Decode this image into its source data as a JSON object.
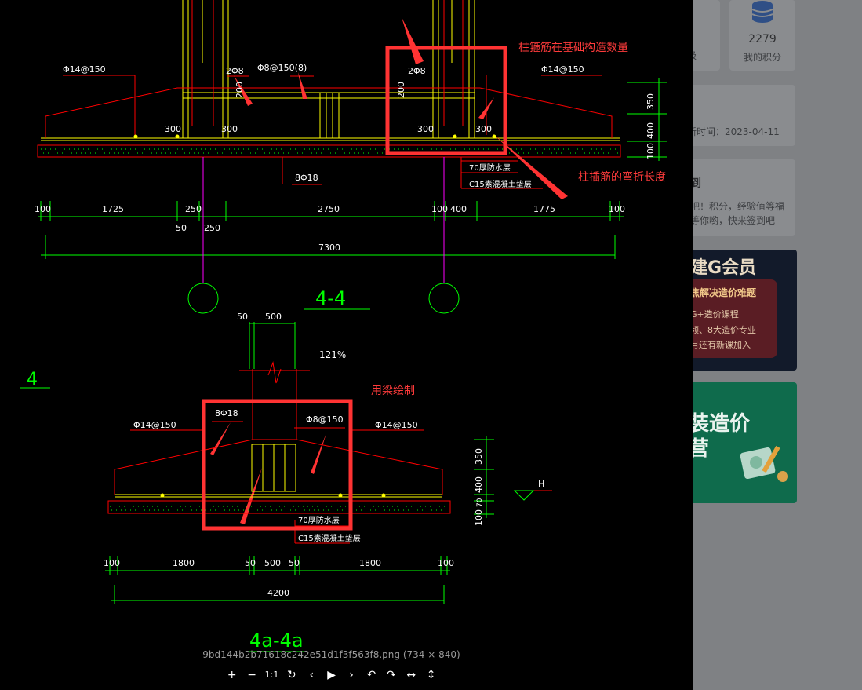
{
  "sidebar": {
    "points_value": "2279",
    "points_label": "我的积分",
    "level_partial": "等级",
    "update_time": "新时间：2023-04-11",
    "signin_title": "到",
    "signin_text_1": "吧！积分，经验值等福",
    "signin_text_2": "等你哟，快来签到吧",
    "promo1_title": "建G会员",
    "promo1_badge": "焦解决造价难题",
    "promo1_line1": "G+造价课程",
    "promo1_line2": "频、8大造价专业",
    "promo1_line3": "月还有新课加入",
    "promo2_title_1": "装造价",
    "promo2_title_2": "营"
  },
  "viewer": {
    "zoom": "121%",
    "caption": "9bd144b2b71618c242e51d1f3f563f8.png (734 × 840)",
    "toolbar": [
      "+",
      "−",
      "1:1",
      "↻",
      "‹",
      "▶",
      "›",
      "↶",
      "↷",
      "↔",
      "↕"
    ]
  },
  "annotations": {
    "stirrup_count": "柱箍筋在基础构造数量",
    "bend_length": "柱插筋的弯折长度",
    "beam_draw": "用梁绘制"
  },
  "drawing": {
    "upper": {
      "rebar_left": "Φ14@150",
      "rebar_right": "Φ14@150",
      "stirrup_a": "2Φ8",
      "stirrup_b": "Φ8@150(8)",
      "stirrup_c": "2Φ8",
      "dim_200a": "200",
      "dim_200b": "200",
      "dim_300_1": "300",
      "dim_300_2": "300",
      "dim_300_3": "300",
      "dim_300_4": "300",
      "bottom_bar": "8Φ18",
      "layer_waterproof": "70厚防水层",
      "layer_cushion": "C15素混凝土垫层",
      "h350": "350",
      "h400": "400",
      "h100": "100",
      "d100_l": "100",
      "d1725": "1725",
      "d250": "250",
      "d50": "50",
      "d250b": "250",
      "d2750": "2750",
      "d100_m": "100",
      "d400": "400",
      "d1775": "1775",
      "d100_r": "100",
      "d7300": "7300",
      "section": "4-4"
    },
    "lower": {
      "left_mark": "4",
      "top_50": "50",
      "top_500": "500",
      "stirrup_8": "8Φ18",
      "stirrup_150": "Φ8@150",
      "rebar_left": "Φ14@150",
      "rebar_right": "Φ14@150",
      "layer_waterproof": "70厚防水层",
      "layer_cushion": "C15素混凝土垫层",
      "h350": "350",
      "h400": "400",
      "h70": "70",
      "h100": "100",
      "level": "H",
      "d100_l": "100",
      "d1800_l": "1800",
      "d50_l": "50",
      "d500": "500",
      "d50_r": "50",
      "d1800_r": "1800",
      "d100_r": "100",
      "d4200": "4200",
      "section": "4a-4a"
    }
  }
}
